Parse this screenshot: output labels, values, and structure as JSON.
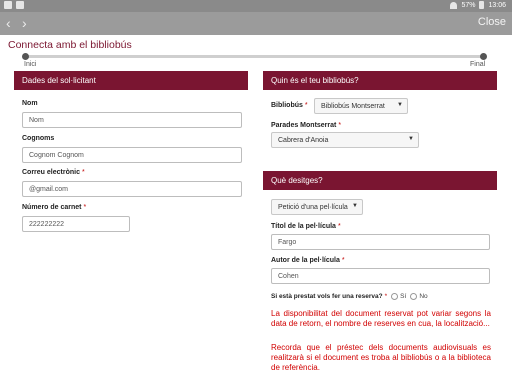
{
  "status": {
    "battery": "57%",
    "time": "13:06"
  },
  "nav": {
    "back": "‹",
    "forward": "›",
    "close": "Close"
  },
  "page_title": "Connecta amb el bibliobús",
  "progress": {
    "start": "Inici",
    "end": "Final"
  },
  "left_panel": {
    "header": "Dades del sol·licitant",
    "fields": {
      "nom": {
        "label": "Nom",
        "placeholder": "Nom"
      },
      "cognoms": {
        "label": "Cognoms",
        "placeholder": "Cognom Cognom"
      },
      "email": {
        "label": "Correu electrònic",
        "required": "*",
        "placeholder": "@gmail.com"
      },
      "carnet": {
        "label": "Número de carnet",
        "required": "*",
        "placeholder": "222222222"
      }
    }
  },
  "right_panel": {
    "header": "Quin és el teu bibliobús?",
    "bibliobus": {
      "label": "Bibliobús",
      "required": "*",
      "value": "Bibliobús Montserrat"
    },
    "parades": {
      "label": "Parades Montserrat",
      "required": "*",
      "value": "Cabrera d'Anoia"
    }
  },
  "request_panel": {
    "header": "Què desitges?",
    "type": {
      "value": "Petició d'una pel·lícula"
    },
    "titol": {
      "label": "Títol de la pel·lícula",
      "required": "*",
      "value": "Fargo"
    },
    "autor": {
      "label": "Autor de la pel·lícula",
      "required": "*",
      "value": "Cohen"
    },
    "reserve": {
      "question": "Si està prestat vols fer una reserva?",
      "required": "*",
      "yes": "Sí",
      "no": "No"
    },
    "messages": [
      "La disponibilitat del document reservat pot variar segons la data de retorn, el nombre de reserves en cua, la localització...",
      "Recorda que el préstec dels documents audiovisuals es realitzarà si el document es troba al bibliobús o a la biblioteca de referència."
    ]
  }
}
